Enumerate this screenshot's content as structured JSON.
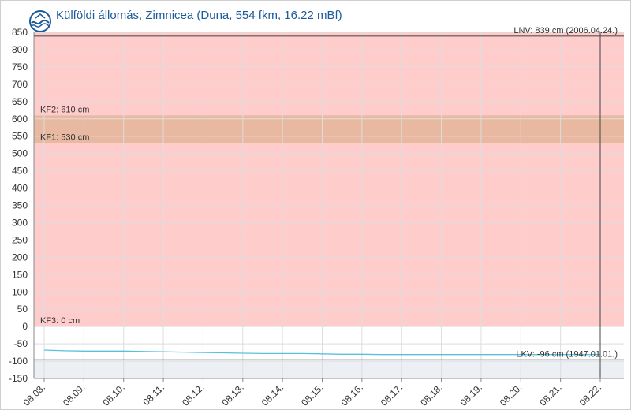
{
  "title": "Külföldi állomás, Zimnicea (Duna, 554 fkm, 16.22 mBf)",
  "logo": {
    "icon": "water-wave-logo-icon",
    "color": "#1c5a99"
  },
  "colors": {
    "danger_zone": "#ffcccc",
    "kf_band": "#e8b8a0",
    "low_zone": "#eceff3",
    "series": "#5bc0de",
    "grid": "#dddddd"
  },
  "chart_data": {
    "type": "line",
    "ylim": [
      -150,
      850
    ],
    "yticks": [
      850,
      800,
      750,
      700,
      650,
      600,
      550,
      500,
      450,
      400,
      350,
      300,
      250,
      200,
      150,
      100,
      50,
      0,
      -50,
      -100,
      -150
    ],
    "categories": [
      "08.08.",
      "08.09.",
      "08.10.",
      "08.11.",
      "08.12.",
      "08.13.",
      "08.14.",
      "08.15.",
      "08.16.",
      "08.17.",
      "08.18.",
      "08.19.",
      "08.20.",
      "08.21.",
      "08.22."
    ],
    "series": [
      {
        "x": [
          0,
          0.5,
          1,
          1.5,
          2,
          2.5,
          3,
          3.5,
          4,
          4.5,
          5,
          5.5,
          6,
          6.5,
          7,
          7.5,
          8,
          8.5,
          9,
          9.5,
          10,
          10.5,
          11,
          11.5,
          12,
          12.5,
          13,
          13.5,
          14
        ],
        "values": [
          -68,
          -70,
          -71,
          -71,
          -71,
          -72,
          -73,
          -74,
          -75,
          -76,
          -77,
          -78,
          -78,
          -78,
          -79,
          -80,
          -80,
          -81,
          -81,
          -81,
          -81,
          -81,
          -81,
          -81,
          -81,
          -81,
          -81,
          -81,
          -81
        ]
      }
    ],
    "zones": [
      {
        "label": "KF2: 610 cm",
        "value": 610
      },
      {
        "label": "KF1: 530 cm",
        "value": 530
      },
      {
        "label": "KF3: 0 cm",
        "value": 0
      }
    ],
    "records": [
      {
        "label": "LNV: 839 cm (2006.04.24.)",
        "value": 839
      },
      {
        "label": "LKV: -96 cm (1947.01.01.)",
        "value": -96
      }
    ],
    "now_line": "08.22."
  }
}
